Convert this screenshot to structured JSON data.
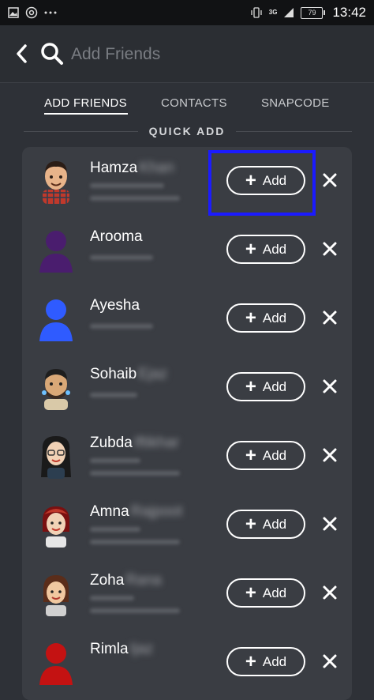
{
  "status_bar": {
    "network": "3G",
    "battery": "79",
    "time": "13:42"
  },
  "header": {
    "search_placeholder": "Add Friends"
  },
  "tabs": [
    {
      "label": "ADD FRIENDS"
    },
    {
      "label": "CONTACTS"
    },
    {
      "label": "SNAPCODE"
    }
  ],
  "section_title": "QUICK ADD",
  "quick_add": [
    {
      "name": "Hamza",
      "add_label": "Add"
    },
    {
      "name": "Arooma",
      "add_label": "Add"
    },
    {
      "name": "Ayesha",
      "add_label": "Add"
    },
    {
      "name": "Sohaib",
      "add_label": "Add"
    },
    {
      "name": "Zubda",
      "add_label": "Add"
    },
    {
      "name": "Amna",
      "add_label": "Add"
    },
    {
      "name": "Zoha",
      "add_label": "Add"
    },
    {
      "name": "Rimla",
      "add_label": "Add"
    }
  ],
  "colors": {
    "background": "#2e3137",
    "card": "#3a3d43",
    "highlight": "#1b1bff"
  }
}
